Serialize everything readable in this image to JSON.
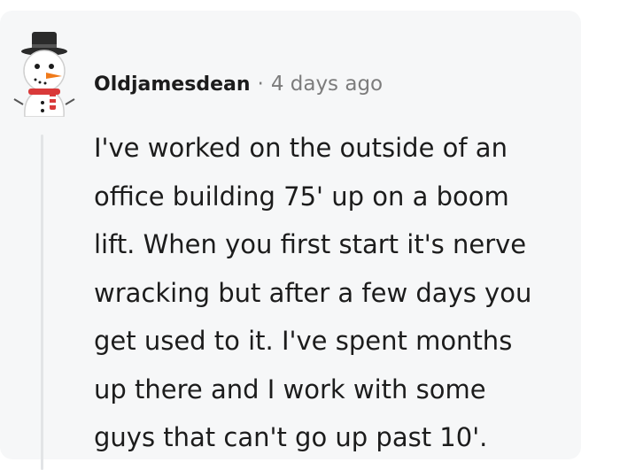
{
  "comment": {
    "author": "Oldjamesdean",
    "separator": "·",
    "timestamp": "4 days ago",
    "body_lines": [
      "I've worked on the outside of an",
      "office building 75' up on a boom",
      "lift. When you first start it's nerve",
      "wracking but after a few days you",
      "get used to it. I've spent months",
      "up there and I work with some",
      "guys that can't go up past 10'."
    ],
    "avatar_icon": "snowman-avatar-icon"
  },
  "colors": {
    "card_background": "#f6f7f8",
    "username": "#1c1c1c",
    "meta": "#7c7c7c",
    "thread_line": "#e2e4e6"
  }
}
